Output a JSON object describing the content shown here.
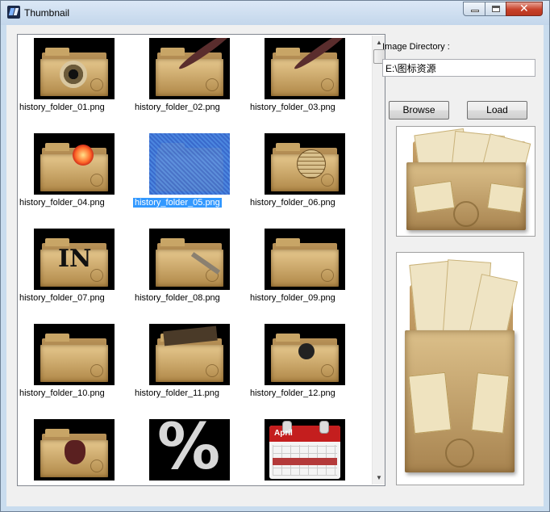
{
  "window": {
    "title": "Thumbnail"
  },
  "thumbnails": [
    {
      "label": "history_folder_01.png",
      "deco": "eye"
    },
    {
      "label": "history_folder_02.png",
      "deco": "quill"
    },
    {
      "label": "history_folder_03.png",
      "deco": "quill"
    },
    {
      "label": "history_folder_04.png",
      "deco": "fire"
    },
    {
      "label": "history_folder_05.png",
      "deco": "none",
      "selected": true
    },
    {
      "label": "history_folder_06.png",
      "deco": "globe"
    },
    {
      "label": "history_folder_07.png",
      "deco": "in",
      "text": "IN"
    },
    {
      "label": "history_folder_08.png",
      "deco": "key"
    },
    {
      "label": "history_folder_09.png",
      "deco": "none"
    },
    {
      "label": "history_folder_10.png",
      "deco": "none"
    },
    {
      "label": "history_folder_11.png",
      "deco": "frame"
    },
    {
      "label": "history_folder_12.png",
      "deco": "lock"
    },
    {
      "label": "",
      "deco": "crest"
    },
    {
      "label": "",
      "deco": "percent",
      "text": "%"
    },
    {
      "label": "",
      "deco": "calendar",
      "text": "April"
    }
  ],
  "right_panel": {
    "dir_label": "Image Directory :",
    "dir_value": "E:\\图标资源",
    "browse_label": "Browse",
    "load_label": "Load"
  },
  "colors": {
    "selection": "#3399ff",
    "close_button": "#c7412a"
  }
}
